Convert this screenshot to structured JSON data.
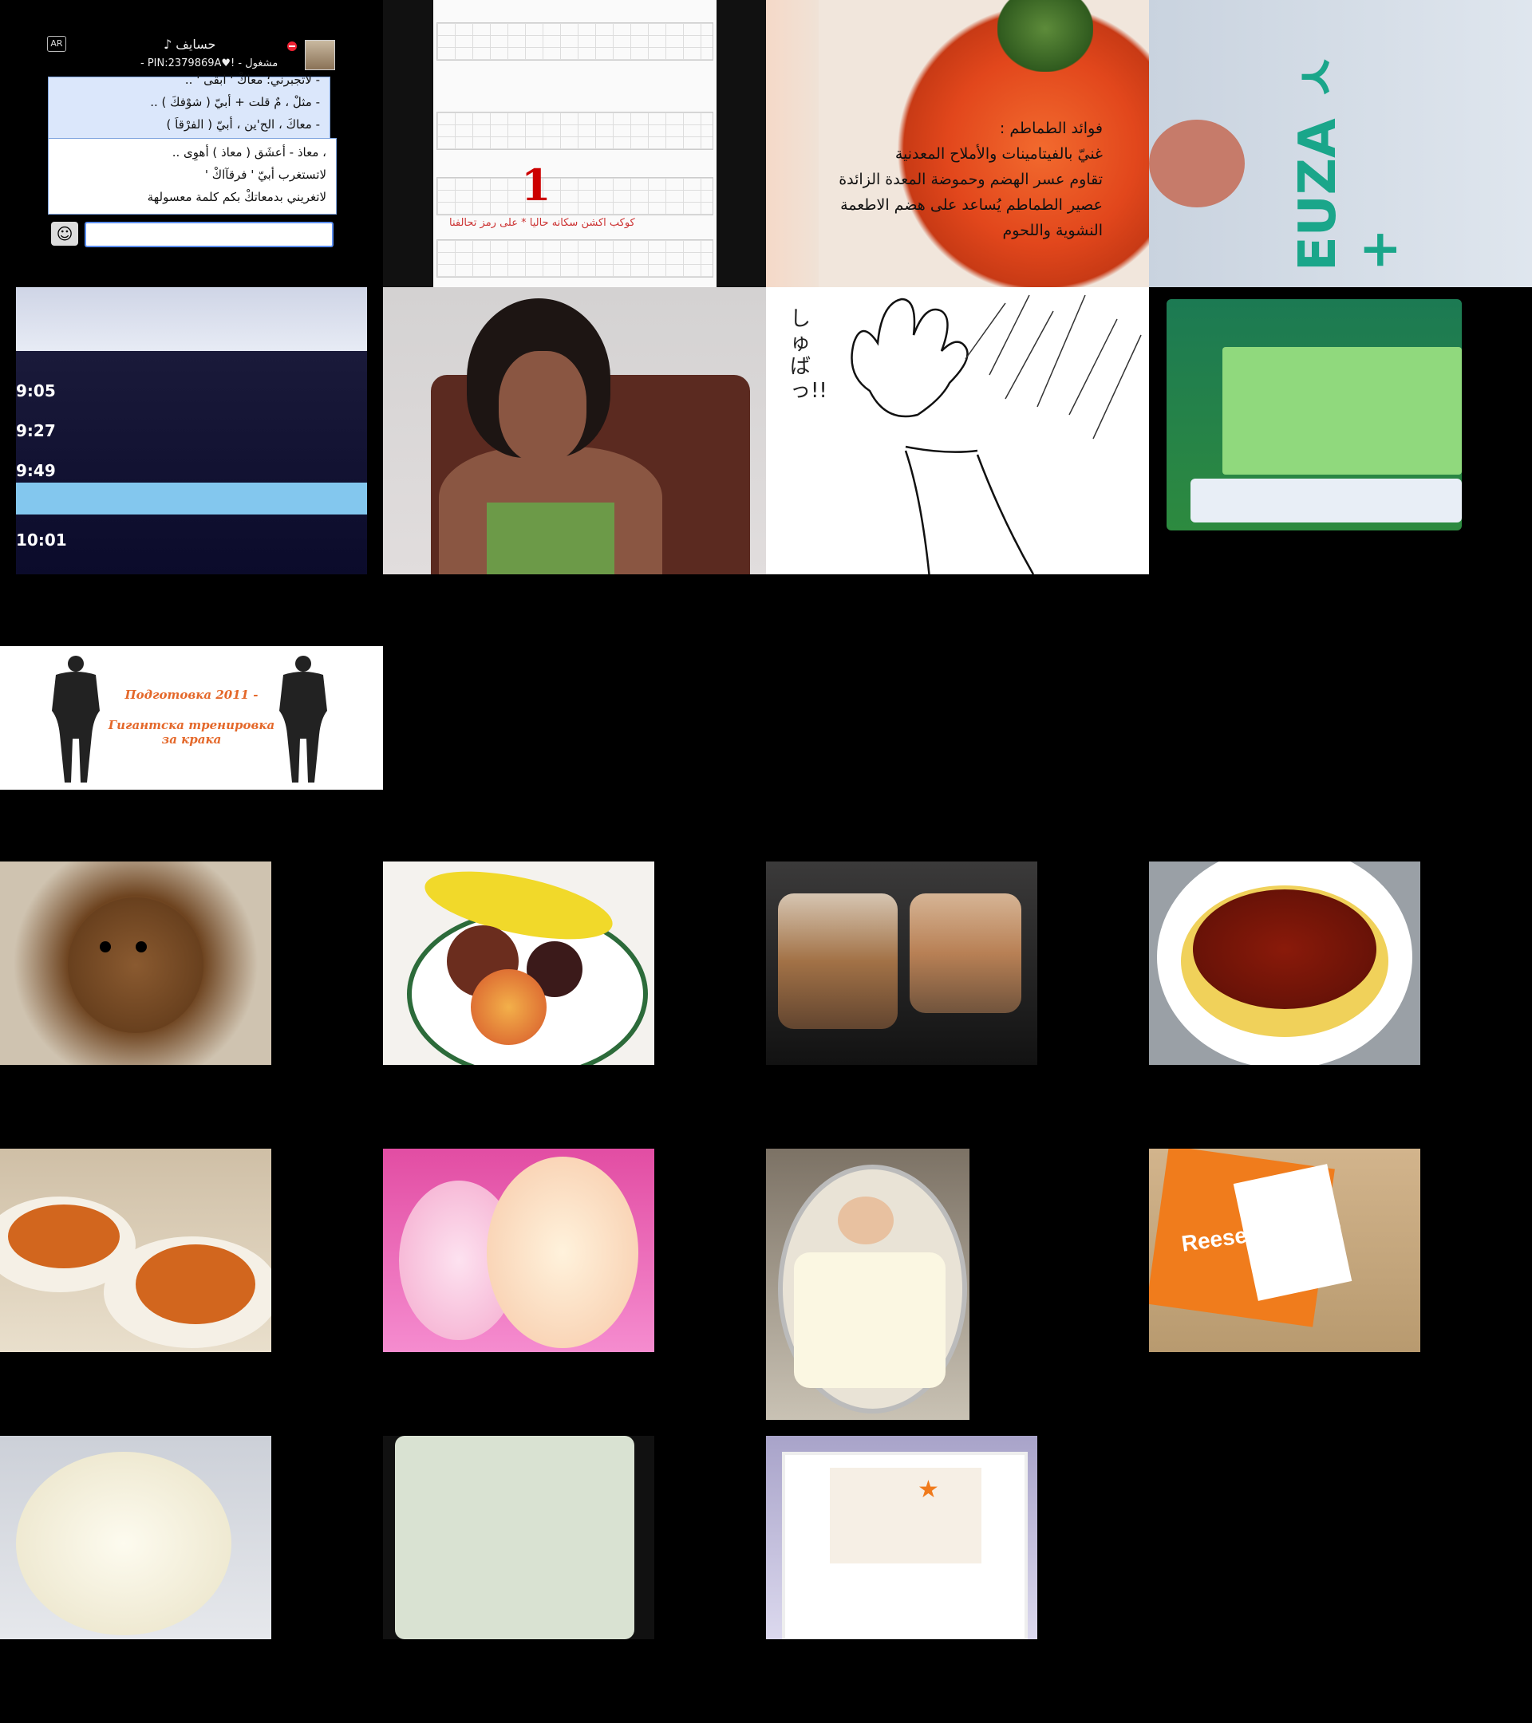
{
  "chat": {
    "badge": "AR",
    "name": "حسايف ♪",
    "status": "مشغول - !♥PIN:2379869A -",
    "lines_top": [
      "- لاتجبرني؛ معاكْ ' ابقى ' ..",
      "- مثلْ ، مٌ قلت + أبيّ ( شوْفكَ ) ..",
      "- معاكَ ، الح'ين ، أبيّ ( الفرْقاَ )"
    ],
    "lines_bottom": [
      "، معاذ - أعشَق ( معاذ ) أهوِى ..",
      "لاتستغرب أبيّ ' فرقآاكْ '",
      "لاتغريني بدمعاتكْ بكم كلمة معسولهة"
    ]
  },
  "game_table": {
    "highlight_number": "1",
    "red_caption": "كوكب اكشن سكانه حاليا * على رمز تحالفنا"
  },
  "tomato": {
    "lines": [
      "فوائد الطماطم :",
      "غنيّ بالفيتامينات والأملاح المعدنية",
      "تقاوم عسر الهضم وحموضة المعدة الزائدة",
      "عصير الطماطم يُساعد على هضم الاطعمة",
      "النشوية واللحوم"
    ]
  },
  "handwriting": {
    "text": "EUZA ㅅ+"
  },
  "tv": {
    "times": [
      "9:05",
      "9:27",
      "9:49",
      "10:01"
    ]
  },
  "manga": {
    "sfx": "しゅばっ!!"
  },
  "banner": {
    "line1": "Подготовка 2011 -",
    "line2": "Гигантска тренировка",
    "line3": "за крака"
  },
  "candy_label": "Reese's Pieces"
}
